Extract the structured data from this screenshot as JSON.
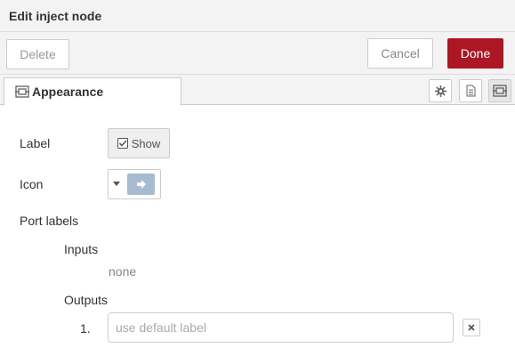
{
  "tray": {
    "title": "Edit inject node"
  },
  "actions": {
    "delete_label": "Delete",
    "cancel_label": "Cancel",
    "done_label": "Done"
  },
  "tabs": [
    {
      "label": "Appearance",
      "icon": "appearance-icon"
    }
  ],
  "tab_icons": [
    "gear-icon",
    "document-icon",
    "appearance-icon"
  ],
  "form": {
    "label_label": "Label",
    "show_label": "Show",
    "icon_label": "Icon",
    "port_labels_label": "Port labels",
    "inputs_label": "Inputs",
    "inputs_value": "none",
    "outputs_label": "Outputs",
    "output_rows": [
      {
        "index": "1.",
        "value": "",
        "placeholder": "use default label"
      }
    ]
  },
  "colors": {
    "done": "#ad1625",
    "node_icon_bg": "#a6bbcf",
    "header_bg": "#f3f3f3"
  }
}
